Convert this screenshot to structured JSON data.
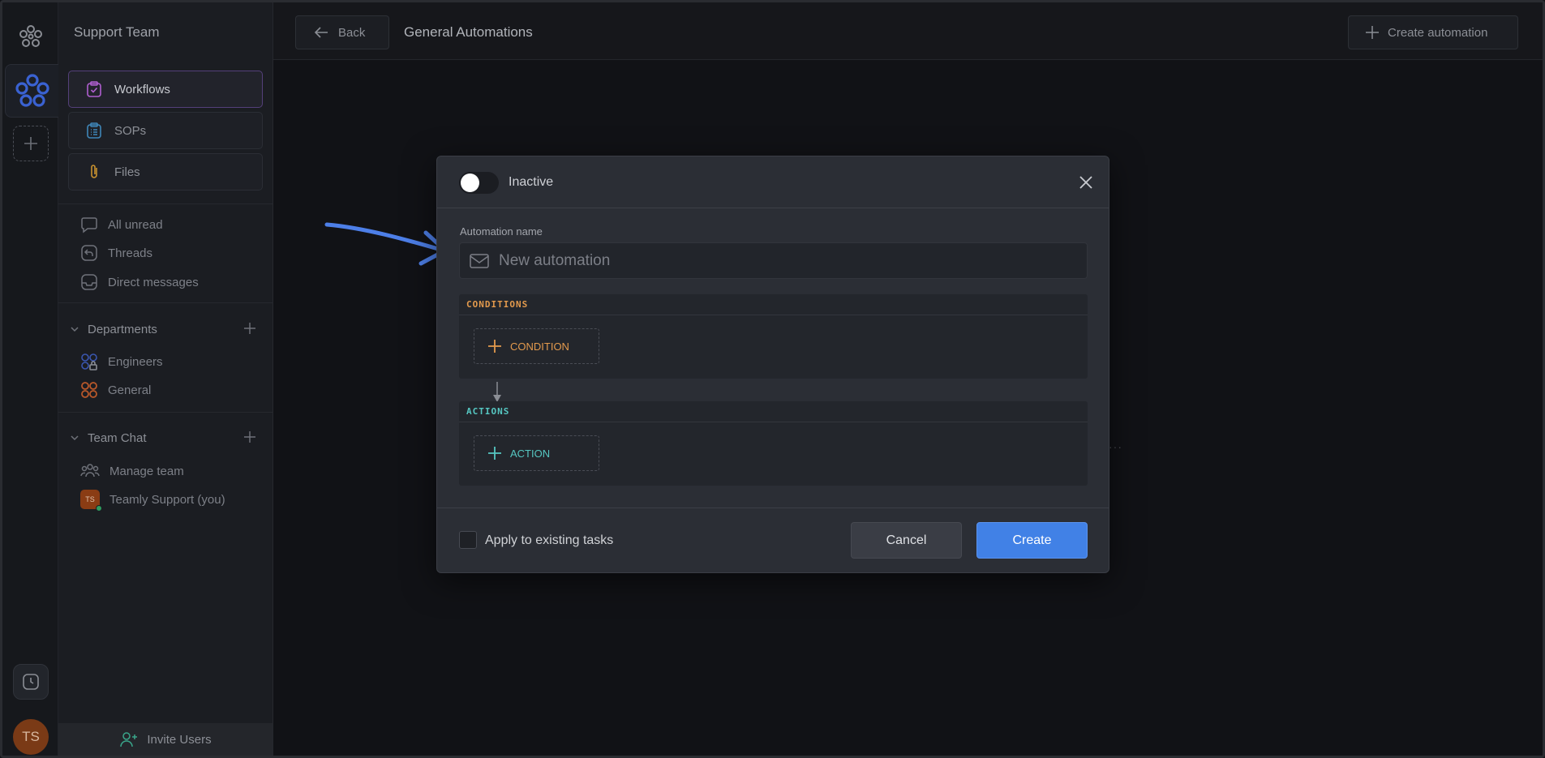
{
  "workspace": {
    "team_title": "Support Team",
    "user_initials": "TS"
  },
  "sidebar": {
    "cards": [
      {
        "label": "Workflows",
        "icon": "clipboard-check-icon",
        "color": "#b05fd0"
      },
      {
        "label": "SOPs",
        "icon": "list-clipboard-icon",
        "color": "#3f86b8"
      },
      {
        "label": "Files",
        "icon": "paperclip-icon",
        "color": "#c9922f"
      }
    ],
    "links": [
      {
        "label": "All unread",
        "icon": "chat-bubble-icon"
      },
      {
        "label": "Threads",
        "icon": "reply-thread-icon"
      },
      {
        "label": "Direct messages",
        "icon": "inbox-icon"
      }
    ],
    "departments": {
      "title": "Departments",
      "items": [
        {
          "label": "Engineers",
          "icon": "group-lock-icon",
          "color": "#3a56b0"
        },
        {
          "label": "General",
          "icon": "four-circles-icon",
          "color": "#b9582a"
        }
      ]
    },
    "team_chat": {
      "title": "Team Chat",
      "items": [
        {
          "label": "Manage team",
          "icon": "people-icon"
        },
        {
          "label": "Teamly Support (you)",
          "icon": "user-badge",
          "badge": "TS"
        }
      ]
    },
    "invite_label": "Invite Users"
  },
  "topbar": {
    "back_label": "Back",
    "title": "General Automations",
    "create_label": "Create automation"
  },
  "modal": {
    "status_label": "Inactive",
    "field_label": "Automation name",
    "name_placeholder": "New automation",
    "conditions": {
      "title": "CONDITIONS",
      "button": "CONDITION",
      "color": "#e39a4d"
    },
    "actions": {
      "title": "ACTIONS",
      "button": "ACTION",
      "color": "#56c7c2"
    },
    "apply_label": "Apply to existing tasks",
    "cancel_label": "Cancel",
    "create_label": "Create"
  },
  "colors": {
    "accent": "#4181e6",
    "annotation_arrow": "#4d7fe8"
  }
}
